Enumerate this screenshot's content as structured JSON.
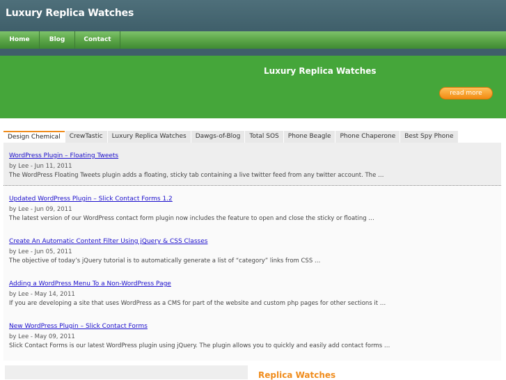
{
  "site": {
    "title": "Luxury Replica Watches"
  },
  "nav": {
    "items": [
      "Home",
      "Blog",
      "Contact"
    ]
  },
  "banner": {
    "title": "Luxury Replica Watches",
    "read_more": "read more"
  },
  "tabs": [
    "Design Chemical",
    "CrewTastic",
    "Luxury Replica Watches",
    "Dawgs-of-Blog",
    "Total SOS",
    "Phone Beagle",
    "Phone Chaperone",
    "Best Spy Phone"
  ],
  "active_tab": "Design Chemical",
  "posts": [
    {
      "title": "WordPress Plugin – Floating Tweets",
      "meta": "by Lee - Jun 11, 2011",
      "excerpt": "The WordPress Floating Tweets plugin adds a floating, sticky tab containing a live twitter feed from any twitter account. The …"
    },
    {
      "title": "Updated WordPress Plugin – Slick Contact Forms 1.2",
      "meta": "by Lee - Jun 09, 2011",
      "excerpt": "The latest version of our WordPress contact form plugin now includes the feature to open and close the sticky or floating …"
    },
    {
      "title": "Create An Automatic Content Filter Using jQuery & CSS Classes",
      "meta": "by Lee - Jun 05, 2011",
      "excerpt": "The objective of today’s jQuery tutorial is to automatically generate a list of “category” links from CSS …"
    },
    {
      "title": "Adding a WordPress Menu To a Non-WordPress Page",
      "meta": "by Lee - May 14, 2011",
      "excerpt": "If you are developing a site that uses WordPress as a CMS for part of the website and custom php pages for other sections it …"
    },
    {
      "title": "New WordPress Plugin – Slick Contact Forms",
      "meta": "by Lee - May 09, 2011",
      "excerpt": "Slick Contact Forms is our latest WordPress plugin using jQuery. The plugin allows you to quickly and easily add contact forms …"
    }
  ],
  "bottom": {
    "heading": "Replica Watches"
  },
  "colors": {
    "header": "#46666f",
    "nav": "#5ea84a",
    "banner": "#45a63a",
    "accent": "#f08c1c",
    "link": "#1a0dcc"
  }
}
